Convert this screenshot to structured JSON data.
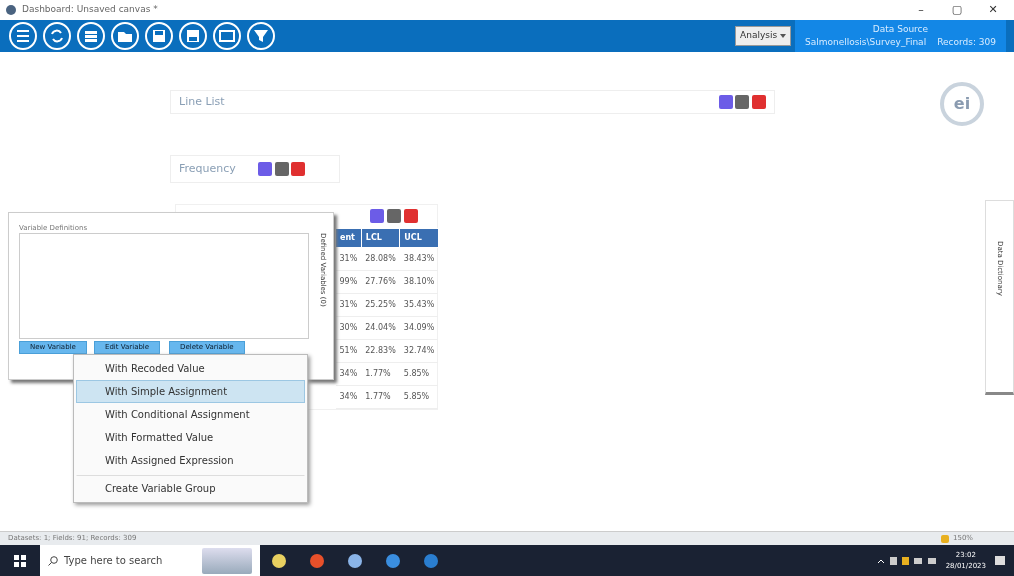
{
  "window": {
    "title": "Dashboard: Unsaved canvas *",
    "controls": [
      "–",
      "▢",
      "✕"
    ]
  },
  "toolbar": {
    "buttons": [
      {
        "kind": "list"
      },
      {
        "kind": "refresh"
      },
      {
        "kind": "stack"
      },
      {
        "kind": "folder"
      },
      {
        "kind": "save"
      },
      {
        "kind": "saveas"
      },
      {
        "kind": "monitor"
      },
      {
        "kind": "filter"
      }
    ],
    "mode_select": "Analysis",
    "data_source": {
      "label": "Data Source",
      "name": "Salmonellosis\\Survey_Final",
      "records": "Records: 309"
    }
  },
  "logo": "ei",
  "gadgets": [
    {
      "title": "Line List"
    },
    {
      "title": "Frequency"
    }
  ],
  "frequency_table": {
    "columns": [
      "ent",
      "LCL",
      "UCL"
    ],
    "rows": [
      [
        "31%",
        "28.08%",
        "38.43%"
      ],
      [
        "99%",
        "27.76%",
        "38.10%"
      ],
      [
        "31%",
        "25.25%",
        "35.43%"
      ],
      [
        "30%",
        "24.04%",
        "34.09%"
      ],
      [
        "51%",
        "22.83%",
        "32.74%"
      ],
      [
        "34%",
        "1.77%",
        "5.85%"
      ],
      [
        "34%",
        "1.77%",
        "5.85%"
      ]
    ]
  },
  "variables_panel": {
    "label": "Variable Definitions",
    "side_tab": "Defined Variables (0)",
    "buttons": [
      "New Variable",
      "Edit Variable",
      "Delete Variable"
    ]
  },
  "context_menu": {
    "items": [
      {
        "label": "With Recoded Value",
        "selected": false,
        "separator": false
      },
      {
        "label": "With Simple Assignment",
        "selected": true,
        "separator": false
      },
      {
        "label": "With Conditional Assignment",
        "selected": false,
        "separator": false
      },
      {
        "label": "With Formatted Value",
        "selected": false,
        "separator": false
      },
      {
        "label": "With Assigned Expression",
        "selected": false,
        "separator": false
      },
      {
        "label": "Create Variable Group",
        "selected": false,
        "separator": true
      }
    ]
  },
  "right_panel": {
    "label": "Data Dictionary"
  },
  "status_bar": {
    "text": "Datasets: 1; Fields: 91; Records: 309",
    "zoom": "150%"
  },
  "taskbar": {
    "search_placeholder": "Type here to search",
    "time": "23:02",
    "date": "28/01/2023"
  }
}
